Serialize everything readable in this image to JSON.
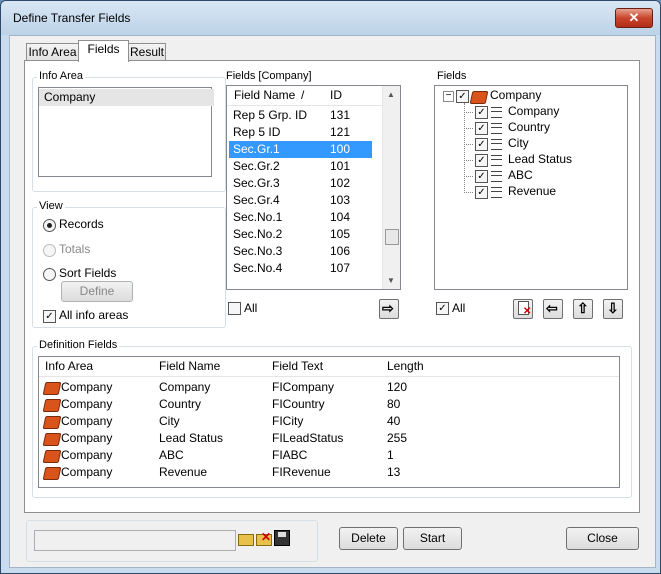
{
  "window": {
    "title": "Define Transfer Fields",
    "close_label": "✕"
  },
  "tabs": [
    {
      "label": "Info Area"
    },
    {
      "label": "Fields"
    },
    {
      "label": "Result"
    }
  ],
  "info_area": {
    "label": "Info Area",
    "items": [
      "Company"
    ]
  },
  "view": {
    "label": "View",
    "options": [
      {
        "label": "Records",
        "selected": true,
        "enabled": true
      },
      {
        "label": "Totals",
        "selected": false,
        "enabled": false
      },
      {
        "label": "Sort Fields",
        "selected": false,
        "enabled": true
      }
    ],
    "define_label": "Define",
    "all_info_label": "All info areas",
    "all_info_checked": true
  },
  "fields_list": {
    "label": "Fields [Company]",
    "col_name": "Field Name",
    "col_id": "ID",
    "sort_marker": "/",
    "rows": [
      {
        "name": "Rep 5 Grp. ID",
        "id": "131"
      },
      {
        "name": "Rep 5 ID",
        "id": "121"
      },
      {
        "name": "Sec.Gr.1",
        "id": "100"
      },
      {
        "name": "Sec.Gr.2",
        "id": "101"
      },
      {
        "name": "Sec.Gr.3",
        "id": "102"
      },
      {
        "name": "Sec.Gr.4",
        "id": "103"
      },
      {
        "name": "Sec.No.1",
        "id": "104"
      },
      {
        "name": "Sec.No.2",
        "id": "105"
      },
      {
        "name": "Sec.No.3",
        "id": "106"
      },
      {
        "name": "Sec.No.4",
        "id": "107"
      }
    ],
    "all_label": "All"
  },
  "fields_tree": {
    "label": "Fields",
    "root": "Company",
    "children": [
      "Company",
      "Country",
      "City",
      "Lead Status",
      "ABC",
      "Revenue"
    ],
    "all_label": "All",
    "toggle": "−"
  },
  "definition": {
    "label": "Definition Fields",
    "headers": [
      "Info Area",
      "Field Name",
      "Field Text",
      "Length"
    ],
    "rows": [
      {
        "area": "Company",
        "name": "Company",
        "text": "FICompany",
        "length": "120"
      },
      {
        "area": "Company",
        "name": "Country",
        "text": "FICountry",
        "length": "80"
      },
      {
        "area": "Company",
        "name": "City",
        "text": "FICity",
        "length": "40"
      },
      {
        "area": "Company",
        "name": "Lead Status",
        "text": "FILeadStatus",
        "length": "255"
      },
      {
        "area": "Company",
        "name": "ABC",
        "text": "FIABC",
        "length": "1"
      },
      {
        "area": "Company",
        "name": "Revenue",
        "text": "FIRevenue",
        "length": "13"
      }
    ]
  },
  "footer": {
    "delete_label": "Delete",
    "start_label": "Start",
    "close_label": "Close"
  },
  "colors": {
    "selection": "#3399ff",
    "book": "#d8541b"
  }
}
